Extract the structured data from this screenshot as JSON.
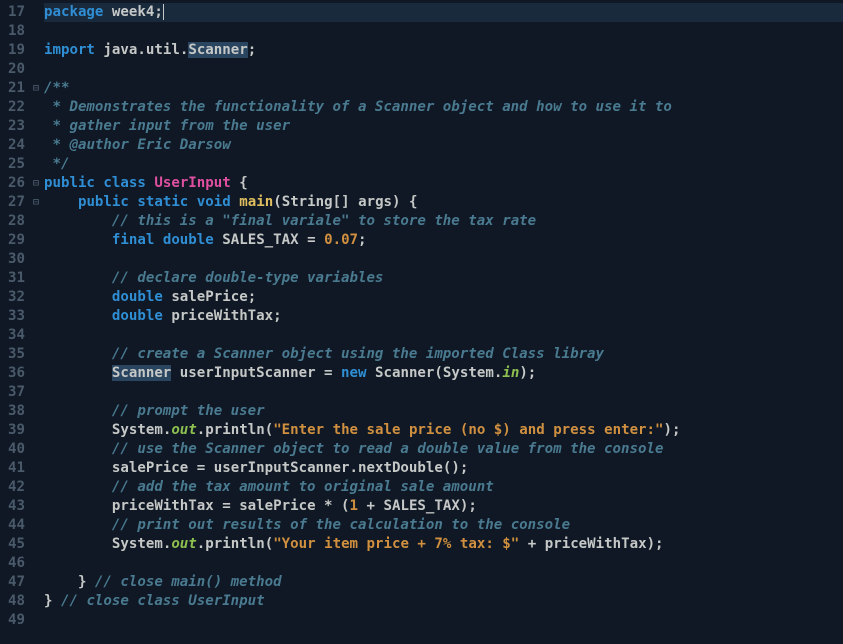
{
  "gutter": {
    "start": 17,
    "end": 49
  },
  "fold": {
    "21": "⊟",
    "26": "⊟",
    "27": "⊟"
  },
  "current_line": 17,
  "code": {
    "17": [
      [
        "kw",
        "package"
      ],
      [
        "plain",
        " "
      ],
      [
        "def",
        "week4"
      ],
      [
        "plain",
        ";"
      ]
    ],
    "18": [
      [
        "plain",
        ""
      ]
    ],
    "19": [
      [
        "kw",
        "import"
      ],
      [
        "plain",
        " "
      ],
      [
        "def",
        "java"
      ],
      [
        "plain",
        "."
      ],
      [
        "def",
        "util"
      ],
      [
        "plain",
        "."
      ],
      [
        "hl def",
        "Scanner"
      ],
      [
        "plain",
        ";"
      ]
    ],
    "20": [
      [
        "plain",
        ""
      ]
    ],
    "21": [
      [
        "doc",
        "/**"
      ]
    ],
    "22": [
      [
        "doc",
        " * Demonstrates the functionality of a Scanner object and how to use it to"
      ]
    ],
    "23": [
      [
        "doc",
        " * gather input from the user"
      ]
    ],
    "24": [
      [
        "doc",
        " * "
      ],
      [
        "doctag",
        "@author"
      ],
      [
        "doc",
        " Eric Darsow"
      ]
    ],
    "25": [
      [
        "doc",
        " */"
      ]
    ],
    "26": [
      [
        "kw",
        "public"
      ],
      [
        "plain",
        " "
      ],
      [
        "kw",
        "class"
      ],
      [
        "plain",
        " "
      ],
      [
        "cls",
        "UserInput"
      ],
      [
        "plain",
        " {"
      ]
    ],
    "27": [
      [
        "plain",
        "    "
      ],
      [
        "kw",
        "public"
      ],
      [
        "plain",
        " "
      ],
      [
        "kw",
        "static"
      ],
      [
        "plain",
        " "
      ],
      [
        "kw",
        "void"
      ],
      [
        "plain",
        " "
      ],
      [
        "id",
        "main"
      ],
      [
        "plain",
        "("
      ],
      [
        "def",
        "String"
      ],
      [
        "plain",
        "[] "
      ],
      [
        "def",
        "args"
      ],
      [
        "plain",
        ") {"
      ]
    ],
    "28": [
      [
        "plain",
        "        "
      ],
      [
        "com",
        "// this is a \"final variale\" to store the tax rate"
      ]
    ],
    "29": [
      [
        "plain",
        "        "
      ],
      [
        "kw",
        "final"
      ],
      [
        "plain",
        " "
      ],
      [
        "kw",
        "double"
      ],
      [
        "plain",
        " "
      ],
      [
        "def",
        "SALES_TAX"
      ],
      [
        "plain",
        " = "
      ],
      [
        "num",
        "0.07"
      ],
      [
        "plain",
        ";"
      ]
    ],
    "30": [
      [
        "plain",
        ""
      ]
    ],
    "31": [
      [
        "plain",
        "        "
      ],
      [
        "com",
        "// declare double-type variables"
      ]
    ],
    "32": [
      [
        "plain",
        "        "
      ],
      [
        "kw",
        "double"
      ],
      [
        "plain",
        " "
      ],
      [
        "def",
        "salePrice"
      ],
      [
        "plain",
        ";"
      ]
    ],
    "33": [
      [
        "plain",
        "        "
      ],
      [
        "kw",
        "double"
      ],
      [
        "plain",
        " "
      ],
      [
        "def",
        "priceWithTax"
      ],
      [
        "plain",
        ";"
      ]
    ],
    "34": [
      [
        "plain",
        ""
      ]
    ],
    "35": [
      [
        "plain",
        "        "
      ],
      [
        "com",
        "// create a Scanner object using the imported Class libray"
      ]
    ],
    "36": [
      [
        "plain",
        "        "
      ],
      [
        "hl def",
        "Scanner"
      ],
      [
        "plain",
        " "
      ],
      [
        "def",
        "userInputScanner"
      ],
      [
        "plain",
        " = "
      ],
      [
        "kw",
        "new"
      ],
      [
        "plain",
        " "
      ],
      [
        "def",
        "Scanner"
      ],
      [
        "plain",
        "("
      ],
      [
        "def",
        "System"
      ],
      [
        "plain",
        "."
      ],
      [
        "field",
        "in"
      ],
      [
        "plain",
        ");"
      ]
    ],
    "37": [
      [
        "plain",
        ""
      ]
    ],
    "38": [
      [
        "plain",
        "        "
      ],
      [
        "com",
        "// prompt the user"
      ]
    ],
    "39": [
      [
        "plain",
        "        "
      ],
      [
        "def",
        "System"
      ],
      [
        "plain",
        "."
      ],
      [
        "field",
        "out"
      ],
      [
        "plain",
        "."
      ],
      [
        "def",
        "println"
      ],
      [
        "plain",
        "("
      ],
      [
        "str",
        "\"Enter the sale price (no $) and press enter:\""
      ],
      [
        "plain",
        ");"
      ]
    ],
    "40": [
      [
        "plain",
        "        "
      ],
      [
        "com",
        "// use the Scanner object to read a double value from the console"
      ]
    ],
    "41": [
      [
        "plain",
        "        "
      ],
      [
        "def",
        "salePrice"
      ],
      [
        "plain",
        " = "
      ],
      [
        "def",
        "userInputScanner"
      ],
      [
        "plain",
        "."
      ],
      [
        "def",
        "nextDouble"
      ],
      [
        "plain",
        "();"
      ]
    ],
    "42": [
      [
        "plain",
        "        "
      ],
      [
        "com",
        "// add the tax amount to original sale amount"
      ]
    ],
    "43": [
      [
        "plain",
        "        "
      ],
      [
        "def",
        "priceWithTax"
      ],
      [
        "plain",
        " = "
      ],
      [
        "def",
        "salePrice"
      ],
      [
        "plain",
        " * ("
      ],
      [
        "num",
        "1"
      ],
      [
        "plain",
        " + "
      ],
      [
        "def",
        "SALES_TAX"
      ],
      [
        "plain",
        ");"
      ]
    ],
    "44": [
      [
        "plain",
        "        "
      ],
      [
        "com",
        "// print out results of the calculation to the console"
      ]
    ],
    "45": [
      [
        "plain",
        "        "
      ],
      [
        "def",
        "System"
      ],
      [
        "plain",
        "."
      ],
      [
        "field",
        "out"
      ],
      [
        "plain",
        "."
      ],
      [
        "def",
        "println"
      ],
      [
        "plain",
        "("
      ],
      [
        "str",
        "\"Your item price + 7% tax: $\""
      ],
      [
        "plain",
        " + "
      ],
      [
        "def",
        "priceWithTax"
      ],
      [
        "plain",
        ");"
      ]
    ],
    "46": [
      [
        "plain",
        ""
      ]
    ],
    "47": [
      [
        "plain",
        "    } "
      ],
      [
        "com",
        "// close main() method"
      ]
    ],
    "48": [
      [
        "plain",
        "} "
      ],
      [
        "com",
        "// close class UserInput"
      ]
    ],
    "49": [
      [
        "plain",
        ""
      ]
    ]
  }
}
